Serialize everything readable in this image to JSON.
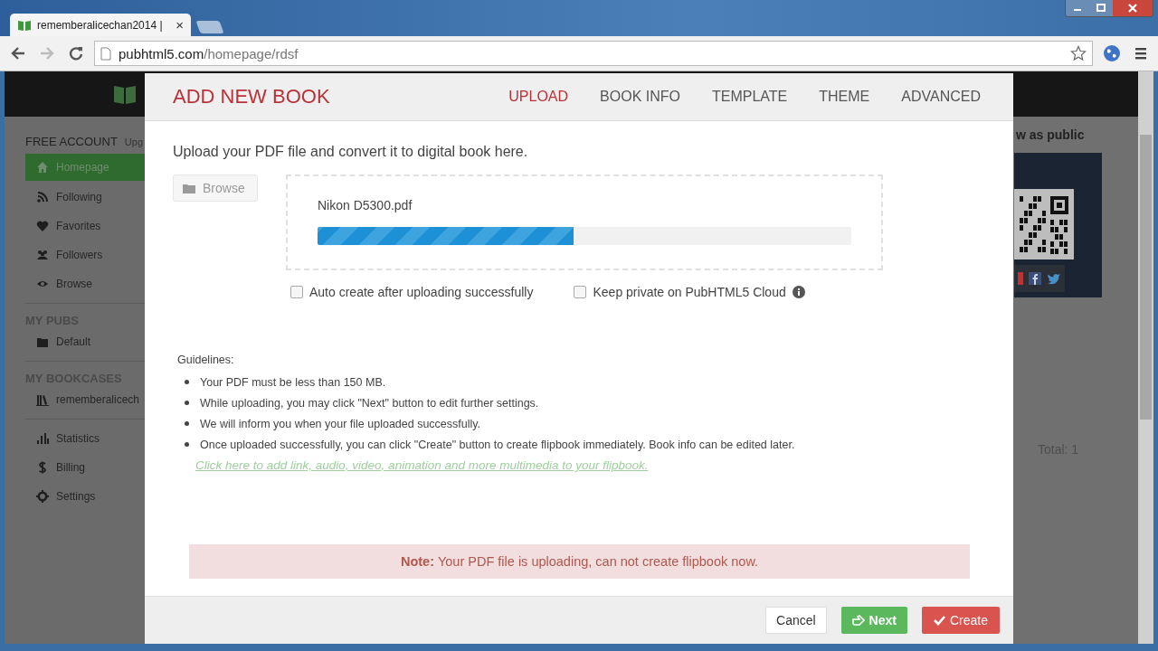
{
  "browser": {
    "tab_title": "rememberalicechan2014 |",
    "tab_close": "×",
    "url_host": "pubhtml5.com",
    "url_path": "/homepage/rdsf"
  },
  "sidebar": {
    "account_label": "FREE ACCOUNT",
    "upgrade_label": "Upg",
    "items": [
      {
        "label": "Homepage",
        "selected": true
      },
      {
        "label": "Following",
        "selected": false
      },
      {
        "label": "Favorites",
        "selected": false
      },
      {
        "label": "Followers",
        "selected": false
      },
      {
        "label": "Browse",
        "selected": false
      }
    ],
    "sections": [
      {
        "title": "MY PUBS",
        "items": [
          {
            "label": "Default"
          }
        ]
      },
      {
        "title": "MY BOOKCASES",
        "items": [
          {
            "label": "rememberalicech"
          }
        ]
      }
    ],
    "bottom_items": [
      {
        "label": "Statistics"
      },
      {
        "label": "Billing"
      },
      {
        "label": "Settings"
      }
    ]
  },
  "right_panel": {
    "view_label": "w as public",
    "total": "Total: 1"
  },
  "dialog": {
    "title": "ADD NEW BOOK",
    "tabs": [
      {
        "label": "UPLOAD",
        "selected": true
      },
      {
        "label": "BOOK INFO",
        "selected": false
      },
      {
        "label": "TEMPLATE",
        "selected": false
      },
      {
        "label": "THEME",
        "selected": false
      },
      {
        "label": "ADVANCED",
        "selected": false
      }
    ],
    "intro": "Upload your PDF file and convert it to digital book here.",
    "browse_button": {
      "label": "Browse",
      "disabled": true
    },
    "upload": {
      "file_name": "Nikon D5300.pdf",
      "level": 0.48
    },
    "options": [
      {
        "label": "Auto create after uploading successfully",
        "checked": false,
        "info": false
      },
      {
        "label": "Keep private on PubHTML5 Cloud",
        "checked": false,
        "info": true
      }
    ],
    "guidelines_title": "Guidelines:",
    "guidelines": [
      "Your PDF must be less than 150 MB.",
      "While uploading, you may click \"Next\" button to edit further settings.",
      "We will inform you when your file uploaded successfully.",
      "Once uploaded successfully, you can click \"Create\" button to create flipbook immediately. Book info can be edited later."
    ],
    "link": "Click here to add link, audio, video, animation and more multimedia to your flipbook.",
    "note": "**Note:**  Your PDF file is uploading, can not create flipbook now.",
    "buttons": [
      {
        "label": "Cancel",
        "kind": "default"
      },
      {
        "label": "Next",
        "kind": "next"
      },
      {
        "label": "Create",
        "kind": "create"
      }
    ]
  }
}
